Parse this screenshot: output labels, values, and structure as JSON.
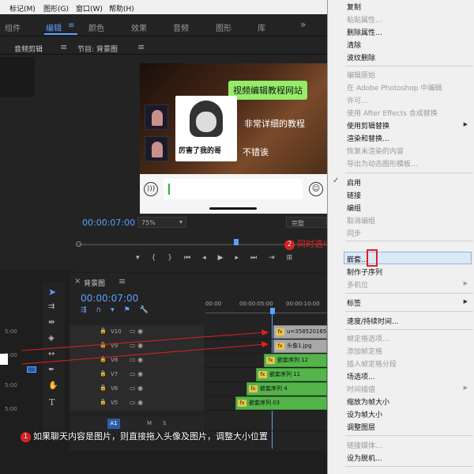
{
  "menubar": {
    "items": [
      "标记(M)",
      "图形(G)",
      "窗口(W)",
      "帮助(H)"
    ]
  },
  "workspace": {
    "tabs": [
      "组件",
      "编辑",
      "颜色",
      "效果",
      "音频",
      "图形",
      "库"
    ],
    "active": "编辑"
  },
  "left_panel": {
    "title": "音频剪辑"
  },
  "program": {
    "title": "节目: 背景图",
    "chat": {
      "bubble1": "视频编辑教程网站",
      "bubble2": "非常详细的教程",
      "bubble3": "不错诶",
      "meme_caption": "厉害了我的哥"
    },
    "timecode": "00:00:07:00",
    "zoom": "75%",
    "quality": "完整"
  },
  "timeline": {
    "title": "背景图",
    "timecode": "00:00:07:00",
    "ruler": [
      "00:00",
      "00:00:05:00",
      "00:00:10:00"
    ],
    "tracks": [
      {
        "name": "V10",
        "clip": "u=3585201659,"
      },
      {
        "name": "V9",
        "clip": "头像1.jpg"
      },
      {
        "name": "V8",
        "clip": "嵌套序列 12"
      },
      {
        "name": "V7",
        "clip": "嵌套序列 11"
      },
      {
        "name": "V6",
        "clip": "嵌套序列 4"
      },
      {
        "name": "V5",
        "clip": "嵌套序列 03"
      }
    ],
    "a1": "A1",
    "ms": [
      "M",
      "S"
    ]
  },
  "left_values": [
    "5:00",
    "5:00",
    "5:00",
    "5:00"
  ],
  "context_menu": {
    "items": [
      {
        "label": "复制",
        "dis": false
      },
      {
        "label": "粘贴属性...",
        "dis": true
      },
      {
        "label": "删除属性...",
        "dis": false
      },
      {
        "label": "清除",
        "dis": false
      },
      {
        "label": "波纹删除",
        "dis": false
      },
      {
        "label": "编辑原始",
        "dis": true
      },
      {
        "label": "在 Adobe Photoshop 中编辑",
        "dis": true
      },
      {
        "label": "许可...",
        "dis": true
      },
      {
        "label": "使用 After Effects 合成替换",
        "dis": true
      },
      {
        "label": "使用剪辑替换",
        "dis": false
      },
      {
        "label": "渲染和替换...",
        "dis": false
      },
      {
        "label": "恢复未渲染的内容",
        "dis": true
      },
      {
        "label": "导出为动态图形模板...",
        "dis": true
      },
      {
        "label": "启用",
        "dis": false
      },
      {
        "label": "链接",
        "dis": false
      },
      {
        "label": "编组",
        "dis": false
      },
      {
        "label": "取消编组",
        "dis": true
      },
      {
        "label": "同步",
        "dis": true
      },
      {
        "label": "嵌套...",
        "dis": false
      },
      {
        "label": "制作子序列",
        "dis": false
      },
      {
        "label": "多机位",
        "dis": true
      },
      {
        "label": "标签",
        "dis": false
      },
      {
        "label": "速度/持续时间...",
        "dis": false
      },
      {
        "label": "帧定格选项...",
        "dis": true
      },
      {
        "label": "添加帧定格",
        "dis": true
      },
      {
        "label": "插入帧定格分段",
        "dis": true
      },
      {
        "label": "场选项...",
        "dis": false
      },
      {
        "label": "时间插值",
        "dis": true
      },
      {
        "label": "缩放为帧大小",
        "dis": false
      },
      {
        "label": "设为帧大小",
        "dis": false
      },
      {
        "label": "调整图层",
        "dis": false
      },
      {
        "label": "链接媒体...",
        "dis": true
      },
      {
        "label": "设为脱机...",
        "dis": false
      }
    ]
  },
  "callouts": {
    "c1_num": "1",
    "c1_text": "如果聊天内容是图片，则直接拖入头像及图片，调整大小位置",
    "c2_num": "2",
    "c2_text": "同时选中头像及图片，设置嵌套"
  },
  "colors": {
    "accent": "#5aa0ff",
    "clip_green": "#53b44a",
    "callout_red": "#e02020"
  }
}
